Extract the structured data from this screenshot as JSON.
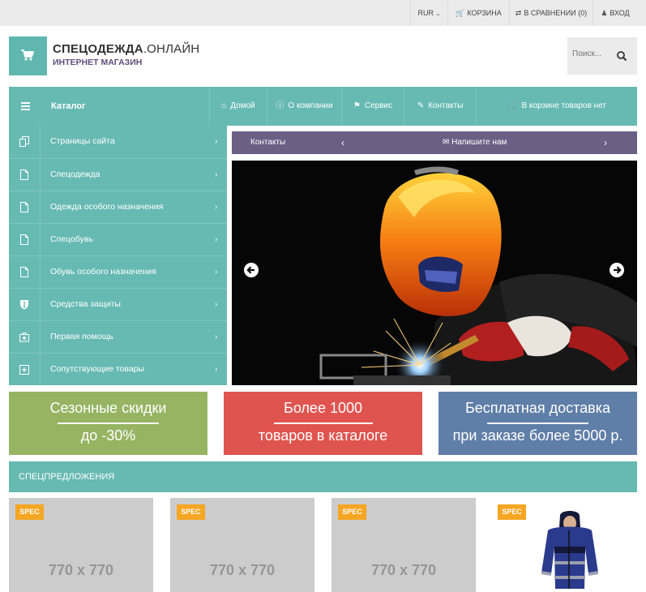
{
  "topbar": {
    "currency": "RUR",
    "cart": "КОРЗИНА",
    "compare": "В СРАВНЕНИИ (0)",
    "login": "ВХОД"
  },
  "header": {
    "brand_main": "СПЕЦОДЕЖДА",
    "brand_suffix": ".ОНЛАЙН",
    "tagline": "ИНТЕРНЕТ МАГАЗИН",
    "search_placeholder": "Поиск..."
  },
  "nav": {
    "catalog": "Каталог",
    "items": [
      "Домой",
      "О компании",
      "Сервис",
      "Контакты"
    ],
    "cart_status": "В корзине товаров нет"
  },
  "sidebar": {
    "items": [
      {
        "label": "Страницы сайта",
        "icon": "pages-icon"
      },
      {
        "label": "Спецодежда",
        "icon": "document-icon"
      },
      {
        "label": "Одежда особого назначения",
        "icon": "document-icon"
      },
      {
        "label": "Спецобувь",
        "icon": "document-icon"
      },
      {
        "label": "Обувь особого назначения",
        "icon": "document-icon"
      },
      {
        "label": "Средства защиты",
        "icon": "shield-icon"
      },
      {
        "label": "Первая помощь",
        "icon": "medkit-icon"
      },
      {
        "label": "Сопутствующие товары",
        "icon": "plus-square-icon"
      }
    ]
  },
  "slider": {
    "contacts": "Контакты",
    "write_us": "Напишите нам"
  },
  "promos": [
    {
      "line1": "Сезонные скидки",
      "line2": "до -30%",
      "color": "#96b462"
    },
    {
      "line1": "Более 1000",
      "line2": "товаров в каталоге",
      "color": "#e0544f"
    },
    {
      "line1": "Бесплатная доставка",
      "line2": "при заказе более 5000 р.",
      "color": "#5f7ea8"
    }
  ],
  "special": {
    "title": "СПЕЦПРЕДЛОЖЕНИЯ",
    "badge": "SPEC",
    "placeholder": "770 x 770"
  },
  "colors": {
    "teal": "#67bab2",
    "purple": "#6b5f86",
    "badge": "#f5a623"
  }
}
